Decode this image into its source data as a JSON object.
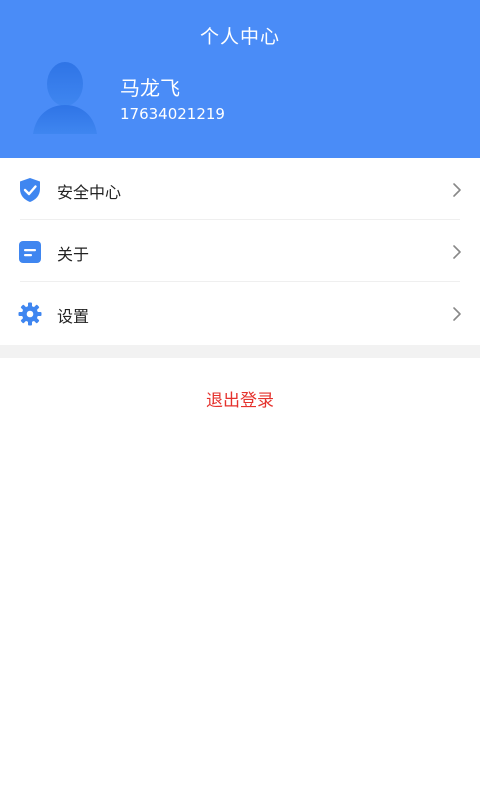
{
  "header": {
    "title": "个人中心",
    "bg_color": "#4a8cf7"
  },
  "profile": {
    "name": "马龙飞",
    "phone": "17634021219",
    "avatar_icon": "user-silhouette-icon"
  },
  "menu": {
    "items": [
      {
        "label": "安全中心",
        "icon": "shield-check-icon"
      },
      {
        "label": "关于",
        "icon": "document-icon"
      },
      {
        "label": "设置",
        "icon": "gear-icon"
      }
    ],
    "chevron_icon": "chevron-right-icon"
  },
  "logout": {
    "label": "退出登录",
    "color": "#e5322d"
  }
}
